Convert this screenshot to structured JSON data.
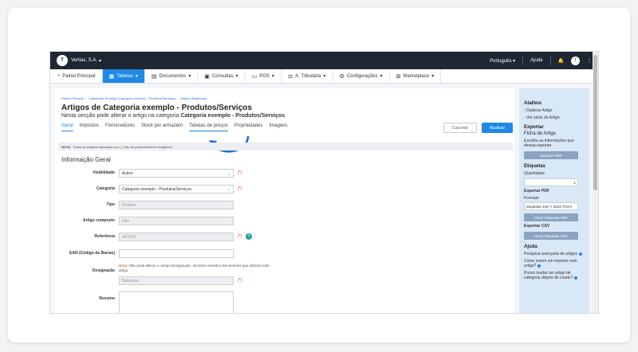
{
  "topbar": {
    "company": "Veritas, S.A.",
    "language": "Português",
    "help": "Ajuda",
    "avatar": "T"
  },
  "nav": [
    {
      "label": "Painel Principal",
      "icon": "dashboard-icon"
    },
    {
      "label": "Tabelas",
      "icon": "tables-icon",
      "active": true
    },
    {
      "label": "Documentos",
      "icon": "documents-icon"
    },
    {
      "label": "Consultas",
      "icon": "queries-icon"
    },
    {
      "label": "POS",
      "icon": "pos-icon"
    },
    {
      "label": "A. Tributária",
      "icon": "tax-icon"
    },
    {
      "label": "Configurações",
      "icon": "settings-icon"
    },
    {
      "label": "Marketplace",
      "icon": "marketplace-icon"
    }
  ],
  "breadcrumb": [
    "Painel Principal",
    "Categorias de artigo (Categoria exemplo - Produtos/Serviços)",
    "Artigos (Balanças)"
  ],
  "page": {
    "title": "Artigos de Categoria exemplo - Produtos/Serviços",
    "subtitle_prefix": "Nesta secção pode alterar o artigo  na categoria",
    "subtitle_bold": "Categoria exemplo - Produtos/Serviços"
  },
  "tabs": [
    "Geral",
    "Impostos",
    "Fornecedores",
    "Stock por armazém",
    "Tabelas de preços",
    "Propriedades",
    "Imagens"
  ],
  "buttons": {
    "cancel": "Cancelar",
    "update": "Atualizar"
  },
  "note": {
    "prefix": "NOTA",
    "text_a": ": Todos os campos marcados com",
    "req": "(*)",
    "text_b": "são de preenchimento obrigatório"
  },
  "section_title": "Informação Geral",
  "form": {
    "visibilidade": {
      "label": "Visibilidade",
      "value": "Activo",
      "req": "(*)"
    },
    "categoria": {
      "label": "Categoria",
      "value": "Categoria exemplo - Produtos/Serviços",
      "req": "(*)"
    },
    "tipo": {
      "label": "Tipo",
      "value": "Produto"
    },
    "composto": {
      "label": "Artigo composto",
      "value": "Não"
    },
    "referencia": {
      "label": "Referência",
      "value": "ART007",
      "req": "(*)",
      "help": "?"
    },
    "ean": {
      "label": "EAN (Código de Barras)",
      "value": ""
    },
    "designacao": {
      "label": "Designação",
      "note_prefix": "Nota:",
      "note_text": "Não pode alterar o campo Designação. Já foram emitidos documentos que utilizam este artigo.",
      "value": "Balanças",
      "req": "(*)"
    },
    "resumo": {
      "label": "Resumo"
    }
  },
  "sidebar": {
    "atalhos": "Atalhos",
    "atalhos_items": [
      "- Duplicar Artigo",
      "- Ver stock do Artigo"
    ],
    "exportar": "Exportar",
    "ficha": "Ficha de Artigo",
    "ficha_desc": "Escolha as informações que deseja exportar",
    "export_pdf": "Exportar PDF",
    "etiquetas": "Etiquetas",
    "quantidade": "Quantidade",
    "quantidade_value": "1",
    "exportar_pdf_head": "Exportar PDF",
    "formato": "Formato",
    "formato_value": "Etiquetas 3x8 (7,00x3,70cm)",
    "gerar_pdf": "Gerar Etiquetas PDF",
    "exportar_csv": "Exportar CSV",
    "gerar_csv": "Gerar Etiquetas CSV",
    "ajuda": "Ajuda",
    "help_links": [
      "Pesquisa avançada de artigos",
      "Como inserir um imposto num artigo?",
      "Posso mudar um artigo de categoria depois de criado?"
    ]
  }
}
